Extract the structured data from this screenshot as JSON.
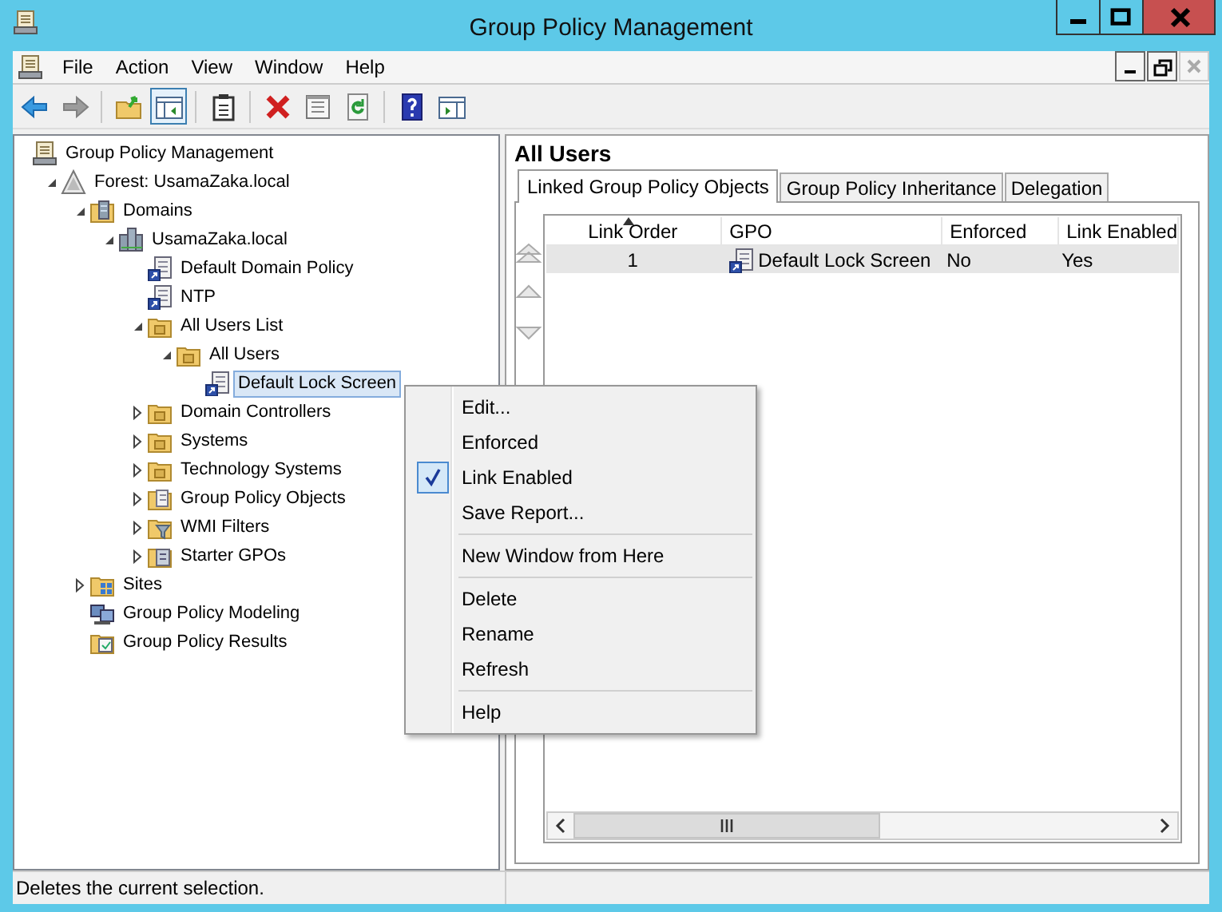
{
  "window": {
    "title": "Group Policy Management",
    "controls": [
      {
        "kind": "minimize"
      },
      {
        "kind": "maximize"
      },
      {
        "kind": "close"
      }
    ]
  },
  "menu_bar": {
    "items": [
      "File",
      "Action",
      "View",
      "Window",
      "Help"
    ],
    "child_controls": [
      {
        "kind": "minimize",
        "disabled": false
      },
      {
        "kind": "restore",
        "disabled": false
      },
      {
        "kind": "close",
        "disabled": true
      }
    ]
  },
  "toolbar": [
    {
      "kind": "back",
      "disabled": false,
      "pressed": false
    },
    {
      "kind": "forward",
      "disabled": true,
      "pressed": false
    },
    {
      "kind": "sep"
    },
    {
      "kind": "up",
      "disabled": false,
      "pressed": false
    },
    {
      "kind": "tree",
      "disabled": false,
      "pressed": true
    },
    {
      "kind": "sep"
    },
    {
      "kind": "clipboard",
      "disabled": false,
      "pressed": false
    },
    {
      "kind": "sep"
    },
    {
      "kind": "delete",
      "disabled": false,
      "pressed": false
    },
    {
      "kind": "properties",
      "disabled": false,
      "pressed": false
    },
    {
      "kind": "refresh",
      "disabled": false,
      "pressed": false
    },
    {
      "kind": "sep"
    },
    {
      "kind": "help",
      "disabled": false,
      "pressed": false
    },
    {
      "kind": "pane",
      "disabled": false,
      "pressed": false
    }
  ],
  "tree": [
    {
      "label": "Group Policy Management",
      "kind": "console",
      "selected": false,
      "children": [
        {
          "label": "Forest: UsamaZaka.local",
          "kind": "forest",
          "selected": false,
          "expanded": true,
          "children": [
            {
              "label": "Domains",
              "kind": "domains",
              "selected": false,
              "expanded": true,
              "children": [
                {
                  "label": "UsamaZaka.local",
                  "kind": "domain",
                  "selected": false,
                  "expanded": true,
                  "children": [
                    {
                      "label": "Default Domain Policy",
                      "kind": "gpo-link",
                      "selected": false
                    },
                    {
                      "label": "NTP",
                      "kind": "gpo-link",
                      "selected": false
                    },
                    {
                      "label": "All Users List",
                      "kind": "ou",
                      "selected": false,
                      "expanded": true,
                      "children": [
                        {
                          "label": "All Users",
                          "kind": "ou",
                          "selected": false,
                          "expanded": true,
                          "children": [
                            {
                              "label": "Default Lock Screen",
                              "kind": "gpo-link",
                              "selected": true
                            }
                          ]
                        }
                      ]
                    },
                    {
                      "label": "Domain Controllers",
                      "kind": "ou",
                      "selected": false,
                      "expanded": false
                    },
                    {
                      "label": "Systems",
                      "kind": "ou",
                      "selected": false,
                      "expanded": false
                    },
                    {
                      "label": "Technology Systems",
                      "kind": "ou",
                      "selected": false,
                      "expanded": false
                    },
                    {
                      "label": "Group Policy Objects",
                      "kind": "gpo-folder",
                      "selected": false,
                      "expanded": false
                    },
                    {
                      "label": "WMI Filters",
                      "kind": "wmi",
                      "selected": false,
                      "expanded": false
                    },
                    {
                      "label": "Starter GPOs",
                      "kind": "starter",
                      "selected": false,
                      "expanded": false
                    }
                  ]
                }
              ]
            },
            {
              "label": "Sites",
              "kind": "sites",
              "selected": false,
              "expanded": false
            },
            {
              "label": "Group Policy Modeling",
              "kind": "modeling",
              "selected": false
            },
            {
              "label": "Group Policy Results",
              "kind": "results",
              "selected": false
            }
          ]
        }
      ]
    }
  ],
  "details": {
    "heading": "All Users",
    "tabs": [
      {
        "label": "Linked Group Policy Objects",
        "selected": true
      },
      {
        "label": "Group Policy Inheritance",
        "selected": false
      },
      {
        "label": "Delegation",
        "selected": false
      }
    ],
    "table": {
      "columns": [
        {
          "label": "Link Order",
          "sorted": true
        },
        {
          "label": "GPO",
          "sorted": false
        },
        {
          "label": "Enforced",
          "sorted": false
        },
        {
          "label": "Link Enabled",
          "sorted": false
        }
      ],
      "rows": [
        {
          "selected": true,
          "cells": [
            "1",
            "Default Lock Screen",
            "No",
            "Yes"
          ]
        }
      ]
    }
  },
  "context_menu": {
    "groups": [
      [
        {
          "label": "Edit...",
          "checked": false
        },
        {
          "label": "Enforced",
          "checked": false
        },
        {
          "label": "Link Enabled",
          "checked": true
        },
        {
          "label": "Save Report...",
          "checked": false
        }
      ],
      [
        {
          "label": "New Window from Here",
          "checked": false
        }
      ],
      [
        {
          "label": "Delete",
          "checked": false
        },
        {
          "label": "Rename",
          "checked": false
        },
        {
          "label": "Refresh",
          "checked": false
        }
      ],
      [
        {
          "label": "Help",
          "checked": false
        }
      ]
    ]
  },
  "status_bar": {
    "text": "Deletes the current selection."
  }
}
